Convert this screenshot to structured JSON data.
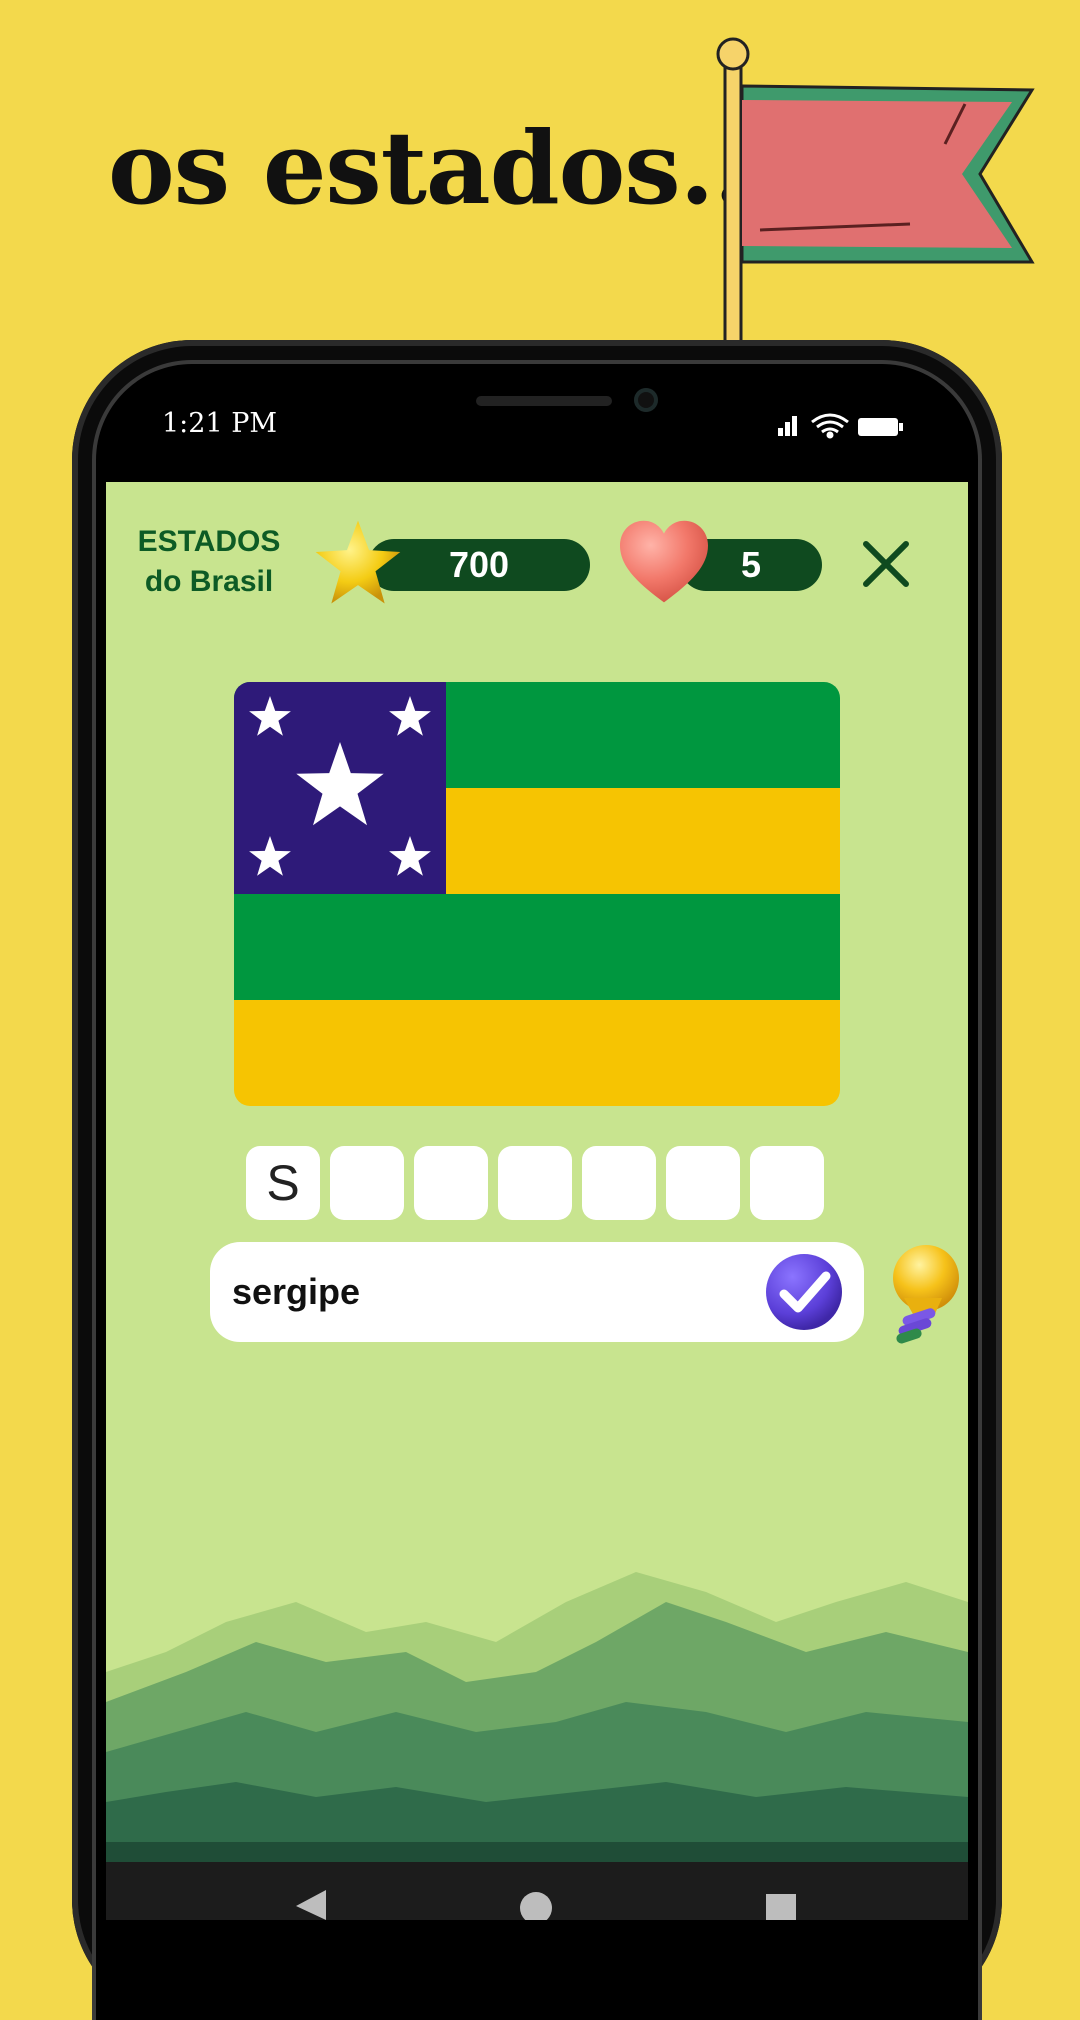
{
  "headline": "os estados...",
  "status_bar": {
    "time": "1:21 PM",
    "icons": [
      "signal-icon",
      "wifi-icon",
      "battery-icon"
    ]
  },
  "header": {
    "brand_line1": "ESTADOS",
    "brand_line2": "do Brasil",
    "score": "700",
    "lives": "5"
  },
  "puzzle": {
    "letters": [
      "S",
      "",
      "",
      "",
      "",
      "",
      ""
    ],
    "flag_colors": {
      "canton": "#2e1a79",
      "green": "#00973f",
      "yellow": "#f6c402",
      "star": "#ffffff"
    }
  },
  "answer": {
    "value": "sergipe",
    "placeholder": ""
  },
  "icons": {
    "star": "star-icon",
    "heart": "heart-icon",
    "close": "close-icon",
    "check": "check-icon",
    "hint": "lightbulb-icon"
  },
  "nav": [
    "back-icon",
    "home-icon",
    "recents-icon"
  ],
  "colors": {
    "background": "#f3d94c",
    "screen": "#c8e48f",
    "brand": "#0d5b25",
    "pill": "#0f4a1f",
    "check": "#5b3fd8"
  }
}
